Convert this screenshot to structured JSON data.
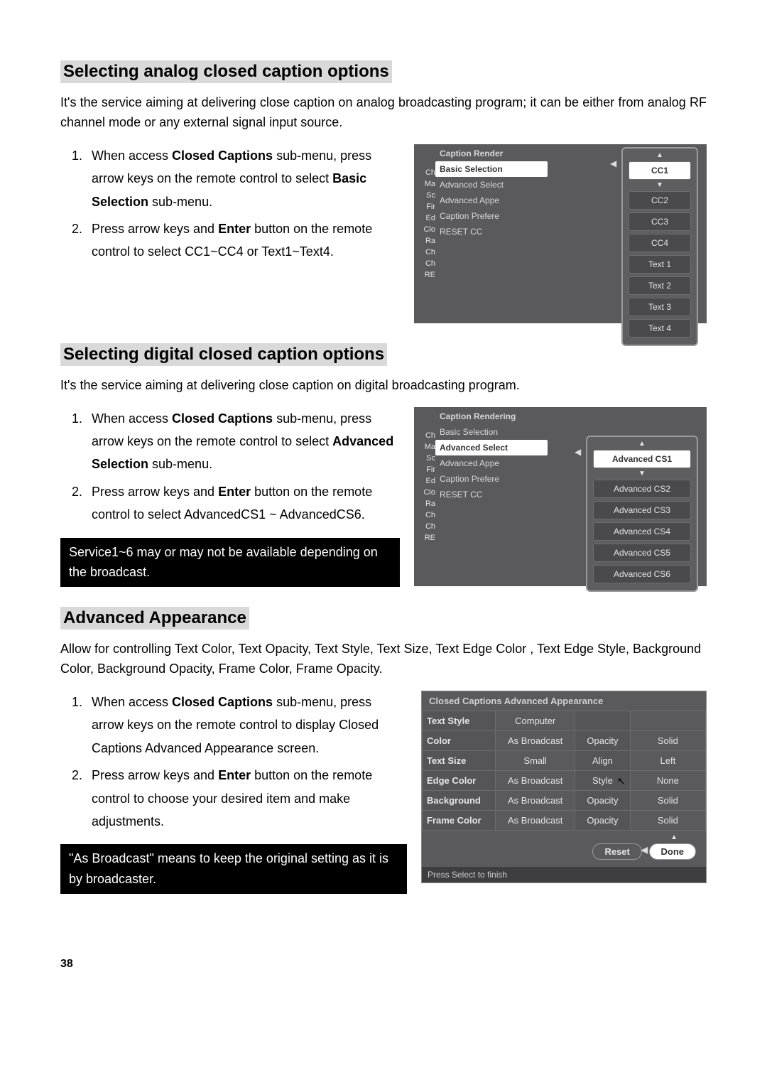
{
  "section1": {
    "heading": "Selecting analog closed caption options",
    "intro": "It's the service aiming at delivering close caption on analog broadcasting program; it can be either from analog RF channel mode or any external signal input source.",
    "step1_a": "When access ",
    "step1_b": "Closed Captions",
    "step1_c": " sub-menu, press arrow keys on the remote control to select ",
    "step1_d": "Basic Selection",
    "step1_e": " sub-menu.",
    "step2_a": "Press arrow keys and ",
    "step2_b": "Enter",
    "step2_c": " button on the remote control to select CC1~CC4 or Text1~Text4."
  },
  "menu1": {
    "sidebar": [
      "Ch",
      "Ma",
      "Sc",
      "Fir",
      "Ed",
      "Clo",
      "Ra",
      "Ch",
      "Ch",
      "RE"
    ],
    "header": "Caption Render",
    "items": [
      "Basic Selection",
      "Advanced Select",
      "Advanced Appe",
      "Caption Prefere",
      "RESET CC"
    ],
    "active_item_index": 0,
    "options": [
      "CC1",
      "CC2",
      "CC3",
      "CC4",
      "Text 1",
      "Text 2",
      "Text 3",
      "Text 4"
    ],
    "selected_option_index": 0
  },
  "section2": {
    "heading": "Selecting digital closed caption options",
    "intro": "It's the service aiming at delivering close caption on digital broadcasting program.",
    "step1_a": "When access ",
    "step1_b": "Closed Captions",
    "step1_c": " sub-menu, press arrow keys on the remote control to select ",
    "step1_d": "Advanced Selection",
    "step1_e": " sub-menu.",
    "step2_a": "Press arrow keys and ",
    "step2_b": "Enter",
    "step2_c": " button on the remote control to select AdvancedCS1 ~ AdvancedCS6.",
    "callout": "Service1~6 may or may not be available depending on the broadcast."
  },
  "menu2": {
    "sidebar": [
      "Ch",
      "Ma",
      "Sc",
      "Fir",
      "Ed",
      "Clo",
      "Ra",
      "Ch",
      "Ch",
      "RE"
    ],
    "header": "Caption Rendering",
    "items": [
      "Basic Selection",
      "Advanced Select",
      "Advanced Appe",
      "Caption Prefere",
      "RESET CC"
    ],
    "active_item_index": 1,
    "options": [
      "Advanced CS1",
      "Advanced CS2",
      "Advanced CS3",
      "Advanced CS4",
      "Advanced CS5",
      "Advanced CS6"
    ],
    "selected_option_index": 0
  },
  "section3": {
    "heading": "Advanced Appearance",
    "intro": "Allow for controlling Text Color, Text Opacity, Text Style, Text Size, Text Edge Color , Text Edge Style, Background Color, Background Opacity, Frame Color, Frame Opacity.",
    "step1_a": "When access ",
    "step1_b": "Closed Captions",
    "step1_c": " sub-menu, press arrow keys on the remote control to display Closed Captions Advanced Appearance screen.",
    "step2_a": "Press arrow keys and ",
    "step2_b": "Enter",
    "step2_c": " button on the remote control to choose your desired item and make adjustments.",
    "callout": "\"As Broadcast\" means to keep the original setting as it is by broadcaster."
  },
  "appearance": {
    "title": "Closed Captions Advanced Appearance",
    "rows": [
      {
        "l": "Text Style",
        "v": "Computer",
        "l2": "",
        "v2": ""
      },
      {
        "l": "Color",
        "v": "As Broadcast",
        "l2": "Opacity",
        "v2": "Solid"
      },
      {
        "l": "Text Size",
        "v": "Small",
        "l2": "Align",
        "v2": "Left"
      },
      {
        "l": "Edge Color",
        "v": "As Broadcast",
        "l2": "Style",
        "v2": "None"
      },
      {
        "l": "Background",
        "v": "As Broadcast",
        "l2": "Opacity",
        "v2": "Solid"
      },
      {
        "l": "Frame Color",
        "v": "As Broadcast",
        "l2": "Opacity",
        "v2": "Solid"
      }
    ],
    "reset": "Reset",
    "done": "Done",
    "footer": "Press Select to finish"
  },
  "page_number": "38"
}
